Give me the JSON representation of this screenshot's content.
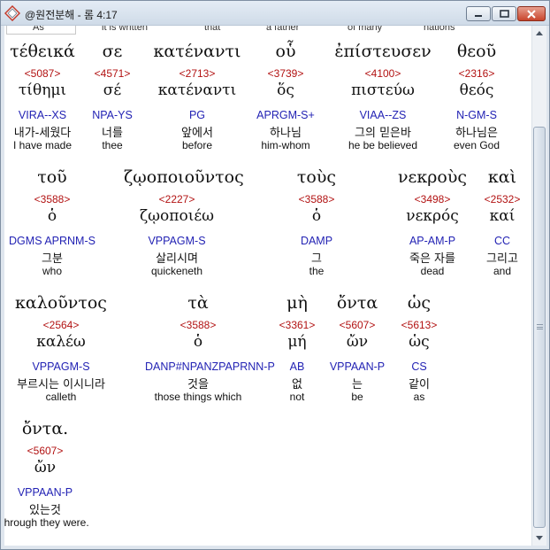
{
  "window": {
    "title": "@원전분해 - 롬 4:17",
    "min_icon": "minimize-icon",
    "max_icon": "maximize-icon",
    "close_icon": "close-icon"
  },
  "previous_line": [
    "As",
    "it is written",
    "that",
    "a father",
    "of many",
    "nations"
  ],
  "rows": [
    [
      {
        "greek": "τέθεικά",
        "strong": "<5087>",
        "lemma": "τίθημι",
        "morph": "VIRA--XS",
        "korean": "내가-세웠다",
        "english": "I have made"
      },
      {
        "greek": "σε",
        "strong": "<4571>",
        "lemma": "σέ",
        "morph": "NPA-YS",
        "korean": "너를",
        "english": "thee"
      },
      {
        "greek": "κατέναντι",
        "strong": "<2713>",
        "lemma": "κατέναντι",
        "morph": "PG",
        "korean": "앞에서",
        "english": "before"
      },
      {
        "greek": "οὗ",
        "strong": "<3739>",
        "lemma": "ὅς",
        "morph": "APRGM-S+",
        "korean": "하나님",
        "english": "him-whom"
      },
      {
        "greek": "ἐπίστευσεν",
        "strong": "<4100>",
        "lemma": "πιστεύω",
        "morph": "VIAA--ZS",
        "korean": "그의 믿은바",
        "english": "he be believed"
      },
      {
        "greek": "θεοῦ",
        "strong": "<2316>",
        "lemma": "θεός",
        "morph": "N-GM-S",
        "korean": "하나님은",
        "english": "even God"
      }
    ],
    [
      {
        "greek": "τοῦ",
        "strong": "<3588>",
        "lemma": "ὁ",
        "morph": "DGMS APRNM-S",
        "korean": "그분",
        "english": "who"
      },
      {
        "greek": "ζῳοποιοῦντος",
        "strong": "<2227>",
        "lemma": "ζῳοποιέω",
        "morph": "VPPAGM-S",
        "korean": "살리시며",
        "english": "quickeneth"
      },
      {
        "greek": "τοὺς",
        "strong": "<3588>",
        "lemma": "ὁ",
        "morph": "DAMP",
        "korean": "그",
        "english": "the"
      },
      {
        "greek": "νεκροὺς",
        "strong": "<3498>",
        "lemma": "νεκρός",
        "morph": "AP-AM-P",
        "korean": "죽은 자를",
        "english": "dead"
      },
      {
        "greek": "καὶ",
        "strong": "<2532>",
        "lemma": "καί",
        "morph": "CC",
        "korean": "그리고",
        "english": "and"
      }
    ],
    [
      {
        "greek": "καλοῦντος",
        "strong": "<2564>",
        "lemma": "καλέω",
        "morph": "VPPAGM-S",
        "korean": "부르시는 이시니라",
        "english": "calleth"
      },
      {
        "greek": "τὰ",
        "strong": "<3588>",
        "lemma": "ὁ",
        "morph": "DANP#NPANZPAPRNN-P",
        "korean": "것을",
        "english": "those things which"
      },
      {
        "greek": "μὴ",
        "strong": "<3361>",
        "lemma": "μή",
        "morph": "AB",
        "korean": "없",
        "english": "not"
      },
      {
        "greek": "ὄντα",
        "strong": "<5607>",
        "lemma": "ὤν",
        "morph": "VPPAAN-P",
        "korean": "는",
        "english": "be"
      },
      {
        "greek": "ὡς",
        "strong": "<5613>",
        "lemma": "ὡς",
        "morph": "CS",
        "korean": "같이",
        "english": "as"
      }
    ],
    [
      {
        "greek": "ὄντα.",
        "strong": "<5607>",
        "lemma": "ὤν",
        "morph": "VPPAAN-P",
        "korean": "있는것",
        "english": "through they were."
      }
    ]
  ],
  "scrollbar": {
    "up_icon": "scroll-up-arrow-icon",
    "down_icon": "scroll-down-arrow-icon"
  }
}
